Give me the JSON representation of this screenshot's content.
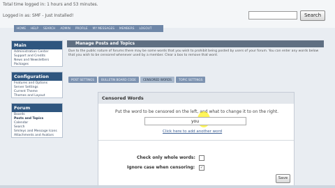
{
  "header": {
    "time_logged": "Total time logged in: 1 hours and 53 minutes.",
    "user_line": "Logged in as: SMF - Just Installed!",
    "search_button": "Search"
  },
  "navbar": {
    "items": [
      "HOME",
      "HELP",
      "SEARCH",
      "ADMIN",
      "PROFILE",
      "MY MESSAGES",
      "MEMBERS",
      "LOGOUT"
    ]
  },
  "sidebar": {
    "main": {
      "title": "Main",
      "items": [
        "Administration Center",
        "Support and Credits",
        "News and Newsletters",
        "Packages"
      ]
    },
    "configuration": {
      "title": "Configuration",
      "items": [
        "Features and Options",
        "Server Settings",
        "Current Theme",
        "Themes and Layout"
      ]
    },
    "forum": {
      "title": "Forum",
      "items": [
        "Boards",
        "Posts and Topics",
        "Calendar",
        "Search",
        "Smileys and Message Icons",
        "Attachments and Avatars"
      ]
    }
  },
  "main": {
    "title": "Manage Posts and Topics",
    "description": "Due to the public nature of forums there may be some words that you wish to prohibit being posted by users of your forum. You can enter any words below that you wish to be censored whenever used by a member. Clear a box to remove that word.",
    "tabs": [
      "POST SETTINGS",
      "BULLETIN BOARD CODE",
      "CENSORED WORDS",
      "TOPIC SETTINGS"
    ]
  },
  "panel": {
    "title": "Censored Words",
    "instruction": "Put the word to be censored on the left, and what to change it to on the right.",
    "word_value": "you",
    "add_link": "Click here to add another word",
    "opt_whole_words": "Check only whole words:",
    "opt_ignore_case": "Ignore case when censoring:",
    "save_button": "Save",
    "ignore_case_check": "✓"
  }
}
